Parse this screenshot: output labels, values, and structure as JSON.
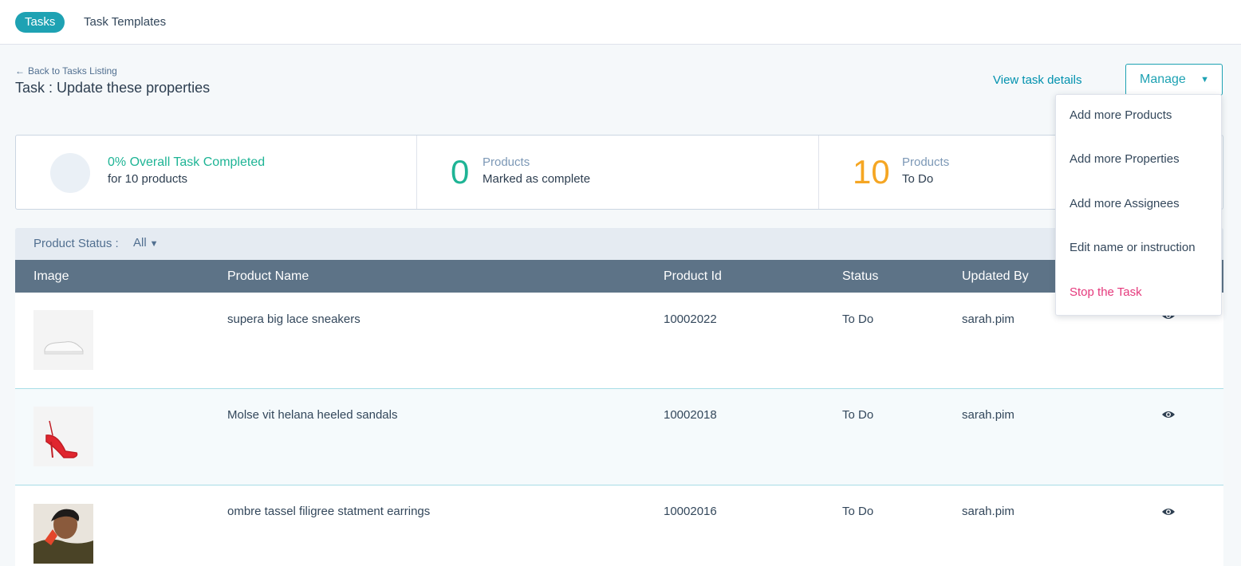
{
  "tabs": {
    "tasks": "Tasks",
    "templates": "Task Templates"
  },
  "header": {
    "back_link": "Back to Tasks Listing",
    "title": "Task : Update these properties",
    "view_details": "View task details",
    "manage": "Manage"
  },
  "stats": {
    "overall_percent": 0,
    "overall_title": "0% Overall Task Completed",
    "overall_sub": "for 10 products",
    "complete_count": "0",
    "complete_label": "Products",
    "complete_sub": "Marked as complete",
    "todo_count": "10",
    "todo_label": "Products",
    "todo_sub": "To Do"
  },
  "filter": {
    "label": "Product Status :",
    "value": "All"
  },
  "table": {
    "headers": {
      "image": "Image",
      "name": "Product Name",
      "id": "Product Id",
      "status": "Status",
      "updated_by": "Updated By"
    },
    "rows": [
      {
        "name": "supera big lace sneakers",
        "id": "10002022",
        "status": "To Do",
        "updated_by": "sarah.pim",
        "image_icon": "sneaker-image"
      },
      {
        "name": "Molse vit helana heeled sandals",
        "id": "10002018",
        "status": "To Do",
        "updated_by": "sarah.pim",
        "image_icon": "sandal-image"
      },
      {
        "name": "ombre tassel filigree statment earrings",
        "id": "10002016",
        "status": "To Do",
        "updated_by": "sarah.pim",
        "image_icon": "earrings-model-image"
      }
    ]
  },
  "manage_menu": {
    "items": [
      "Add more Products",
      "Add more Properties",
      "Add more Assignees",
      "Edit name or instruction",
      "Stop the Task"
    ]
  },
  "colors": {
    "accent": "#1ea2b3",
    "success": "#1eb495",
    "warning": "#f5a623",
    "danger": "#e5397c",
    "table_header": "#5d7387"
  }
}
